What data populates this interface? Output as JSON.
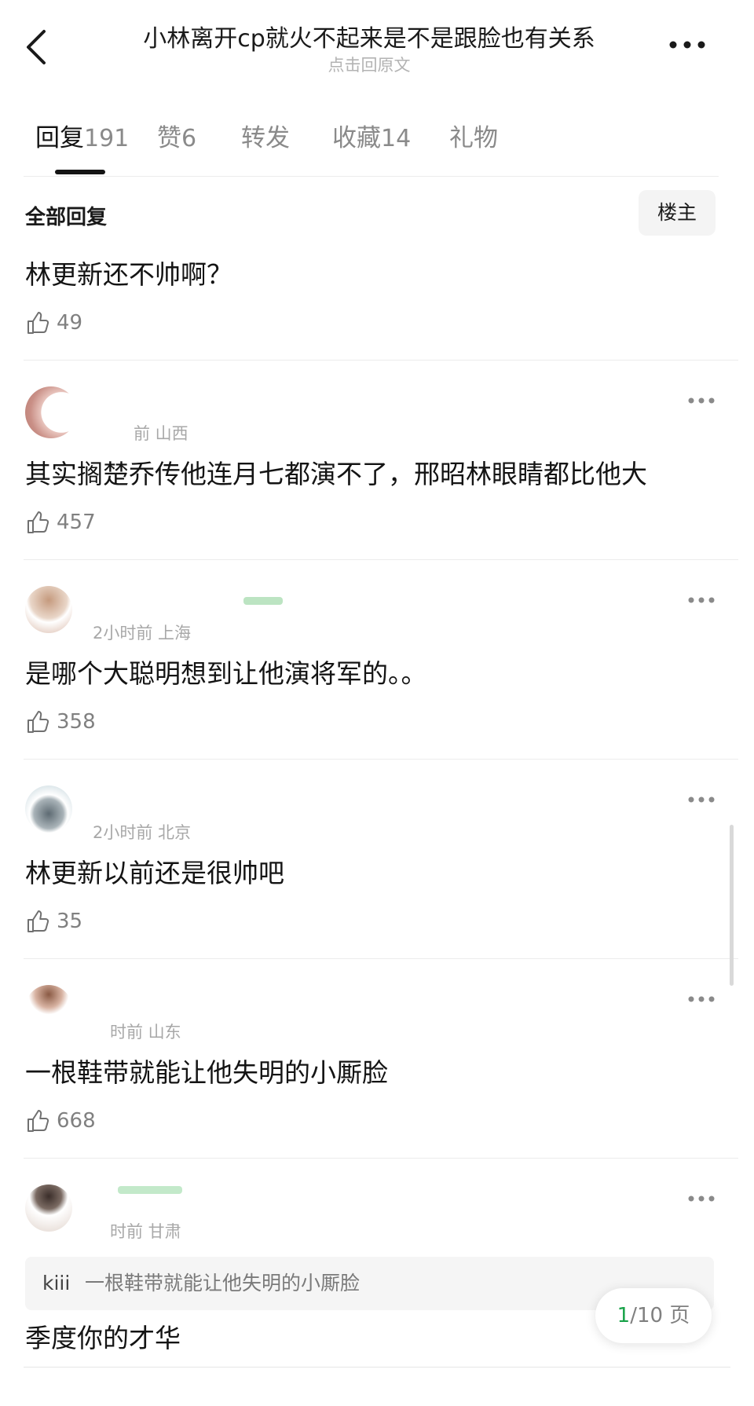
{
  "header": {
    "back_icon": "chevron-left-icon",
    "title": "小林离开cp就火不起来是不是跟脸也有关系",
    "subtitle": "点击回原文",
    "more_icon": "more-horizontal-icon"
  },
  "tabs": [
    {
      "label": "回复",
      "count": "191"
    },
    {
      "label": "赞",
      "count": "6"
    },
    {
      "label": "转发",
      "count": ""
    },
    {
      "label": "收藏",
      "count": "14"
    },
    {
      "label": "礼物",
      "count": ""
    }
  ],
  "filter": {
    "all_label": "全部回复",
    "owner_label": "楼主"
  },
  "comments": [
    {
      "meta": "",
      "text": "林更新还不帅啊？",
      "likes": "49"
    },
    {
      "meta": "前 山西",
      "text": "其实搁楚乔传他连月七都演不了，邢昭林眼睛都比他大",
      "likes": "457"
    },
    {
      "meta": "2小时前 上海",
      "text": "是哪个大聪明想到让他演将军的。。",
      "likes": "358"
    },
    {
      "meta": "2小时前 北京",
      "text": "林更新以前还是很帅吧",
      "likes": "35"
    },
    {
      "meta": "时前 山东",
      "text": "一根鞋带就能让他失明的小厮脸",
      "likes": "668"
    },
    {
      "meta": "时前 甘肃",
      "quote_user": "kiii",
      "quote_text": "一根鞋带就能让他失明的小厮脸",
      "text": "季度你的才华"
    }
  ],
  "pager": {
    "current": "1",
    "rest": "/10 页"
  },
  "colors": {
    "accent_green": "#1aa34a",
    "text": "#141414",
    "muted": "#808080"
  }
}
